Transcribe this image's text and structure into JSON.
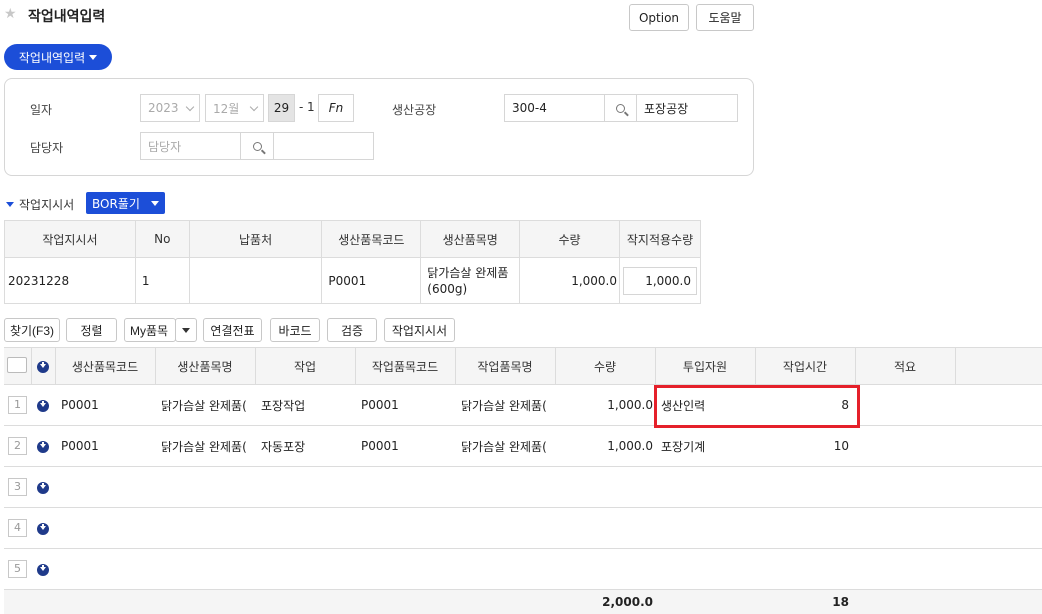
{
  "header": {
    "title": "작업내역입력",
    "option_label": "Option",
    "help_label": "도움말",
    "menu_pill_label": "작업내역입력"
  },
  "form": {
    "date_label": "일자",
    "year": "2023",
    "month": "12월",
    "day": "29",
    "separator": "-",
    "seq": "1",
    "fn_label": "Fn",
    "factory_label": "생산공장",
    "factory_code": "300-4",
    "factory_name": "포장공장",
    "manager_label": "담당자",
    "manager_placeholder": "담당자",
    "manager_name": ""
  },
  "work_order": {
    "section_label": "작업지시서",
    "bor_button_label": "BOR풀기",
    "headers": [
      "작업지시서",
      "No",
      "납품처",
      "생산품목코드",
      "생산품목명",
      "수량",
      "작지적용수량"
    ],
    "row": {
      "order": "20231228",
      "no": "1",
      "customer": "",
      "code": "P0001",
      "name_line1": "닭가슴살 완제품",
      "name_line2": "(600g)",
      "qty": "1,000.0",
      "applied_qty": "1,000.0"
    }
  },
  "toolbar": {
    "find": "찾기(F3)",
    "sort": "정렬",
    "my_items": "My품목",
    "linked": "연결전표",
    "barcode": "바코드",
    "verify": "검증",
    "work_order": "작업지시서"
  },
  "grid": {
    "headers": [
      "생산품목코드",
      "생산품목명",
      "작업",
      "작업품목코드",
      "작업품목명",
      "수량",
      "투입자원",
      "작업시간",
      "적요"
    ],
    "rows": [
      {
        "num": "1",
        "code": "P0001",
        "name": "닭가슴살 완제품(",
        "task": "포장작업",
        "wcode": "P0001",
        "wname": "닭가슴살 완제품(",
        "qty": "1,000.0",
        "resource": "생산인력",
        "time": "8",
        "note": ""
      },
      {
        "num": "2",
        "code": "P0001",
        "name": "닭가슴살 완제품(",
        "task": "자동포장",
        "wcode": "P0001",
        "wname": "닭가슴살 완제품(",
        "qty": "1,000.0",
        "resource": "포장기계",
        "time": "10",
        "note": ""
      },
      {
        "num": "3",
        "code": "",
        "name": "",
        "task": "",
        "wcode": "",
        "wname": "",
        "qty": "",
        "resource": "",
        "time": "",
        "note": ""
      },
      {
        "num": "4",
        "code": "",
        "name": "",
        "task": "",
        "wcode": "",
        "wname": "",
        "qty": "",
        "resource": "",
        "time": "",
        "note": ""
      },
      {
        "num": "5",
        "code": "",
        "name": "",
        "task": "",
        "wcode": "",
        "wname": "",
        "qty": "",
        "resource": "",
        "time": "",
        "note": ""
      }
    ],
    "total_qty": "2,000.0",
    "total_time": "18"
  },
  "colors": {
    "primary": "#1c4ed8",
    "highlight": "#e5202a"
  }
}
